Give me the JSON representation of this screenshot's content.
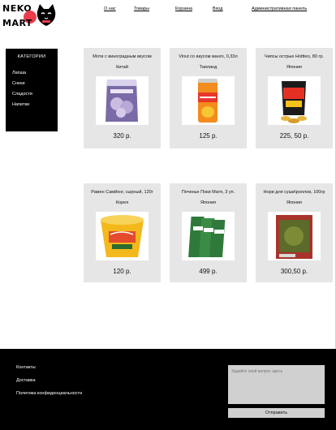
{
  "logo": {
    "line1": "NEKO",
    "line2": "MART"
  },
  "nav": [
    {
      "label": "О нас"
    },
    {
      "label": "Товары"
    },
    {
      "label": "Корзина"
    },
    {
      "label": "Вход"
    },
    {
      "label": "Административная панель"
    }
  ],
  "sidebar": {
    "title": "КАТЕГОРИИ",
    "items": [
      {
        "label": "Лапша"
      },
      {
        "label": "Снеки"
      },
      {
        "label": "Сладости"
      },
      {
        "label": "Напитки"
      }
    ]
  },
  "products": [
    {
      "name": "Моти с виноградным вкусом",
      "country": "Китай",
      "price": "320 р.",
      "image": "mochi-bag-image"
    },
    {
      "name": "Vinut со вкусом манго, 0,33л",
      "country": "Таиланд",
      "price": "125 р.",
      "image": "mango-drink-can-image"
    },
    {
      "name": "Чипсы острые Hottteo, 80 гр.",
      "country": "Япония",
      "price": "225, 50 р.",
      "image": "chips-bag-image"
    },
    {
      "name": "Рамен Самйонг, сырный, 120г",
      "country": "Корея",
      "price": "120 р.",
      "image": "ramen-cup-image"
    },
    {
      "name": "Печенье Поки Матя, 3 уп.",
      "country": "Япония",
      "price": "499 р.",
      "image": "pocky-box-image"
    },
    {
      "name": "Нори для суши\\роллов, 100гр",
      "country": "Япония",
      "price": "300,50 р.",
      "image": "nori-pack-image"
    }
  ],
  "footer": {
    "links": [
      {
        "label": "Контакты"
      },
      {
        "label": "Доставка"
      },
      {
        "label": "Политика конфиденциальности"
      }
    ],
    "question_placeholder": "Задайте свой вопрос здесь",
    "send_label": "Отправить"
  }
}
